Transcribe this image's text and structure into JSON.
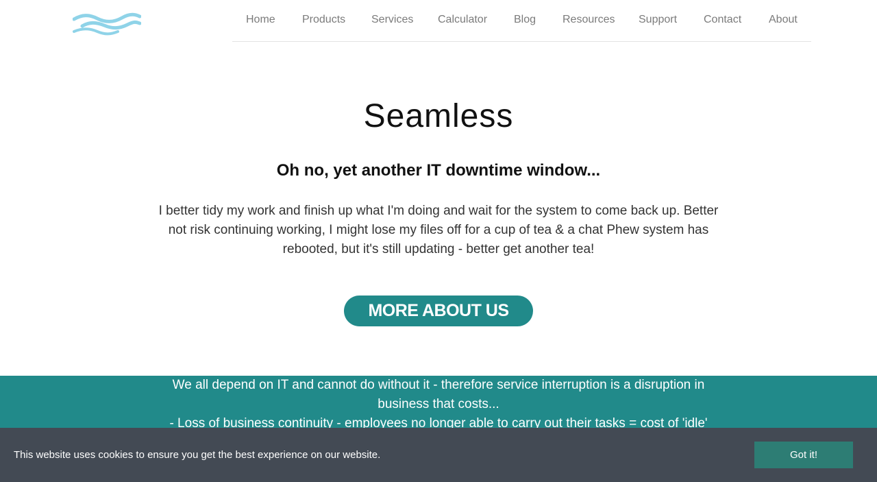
{
  "header": {
    "logo": "waves-logo",
    "nav": [
      {
        "label": "Home"
      },
      {
        "label": "Products"
      },
      {
        "label": "Services"
      },
      {
        "label": "Calculator"
      },
      {
        "label": "Blog"
      },
      {
        "label": "Resources"
      },
      {
        "label": "Support"
      },
      {
        "label": "Contact"
      },
      {
        "label": "About"
      }
    ]
  },
  "hero": {
    "title": "Seamless",
    "subtitle": "Oh no, yet another IT downtime window...",
    "body": "I better tidy my work and finish up what I'm doing and wait for the system to come back up. Better not risk continuing working, I might lose my files off for a cup of tea & a chat Phew system has rebooted, but it's still updating - better get another tea!",
    "button_label": "MORE ABOUT US"
  },
  "band": {
    "line1": "We all depend on IT and cannot do without it - therefore service interruption is a disruption in business that costs...",
    "line2": "- Loss of business continuity - employees no longer able to carry out their tasks = cost of 'idle'"
  },
  "cookie": {
    "message": "This website uses cookies to ensure you get the best experience on our website.",
    "button_label": "Got it!"
  },
  "colors": {
    "accent": "#218a8a",
    "logo": "#8fd3e8",
    "cookie_bg": "#434a54",
    "cookie_button": "#2d7d74"
  }
}
